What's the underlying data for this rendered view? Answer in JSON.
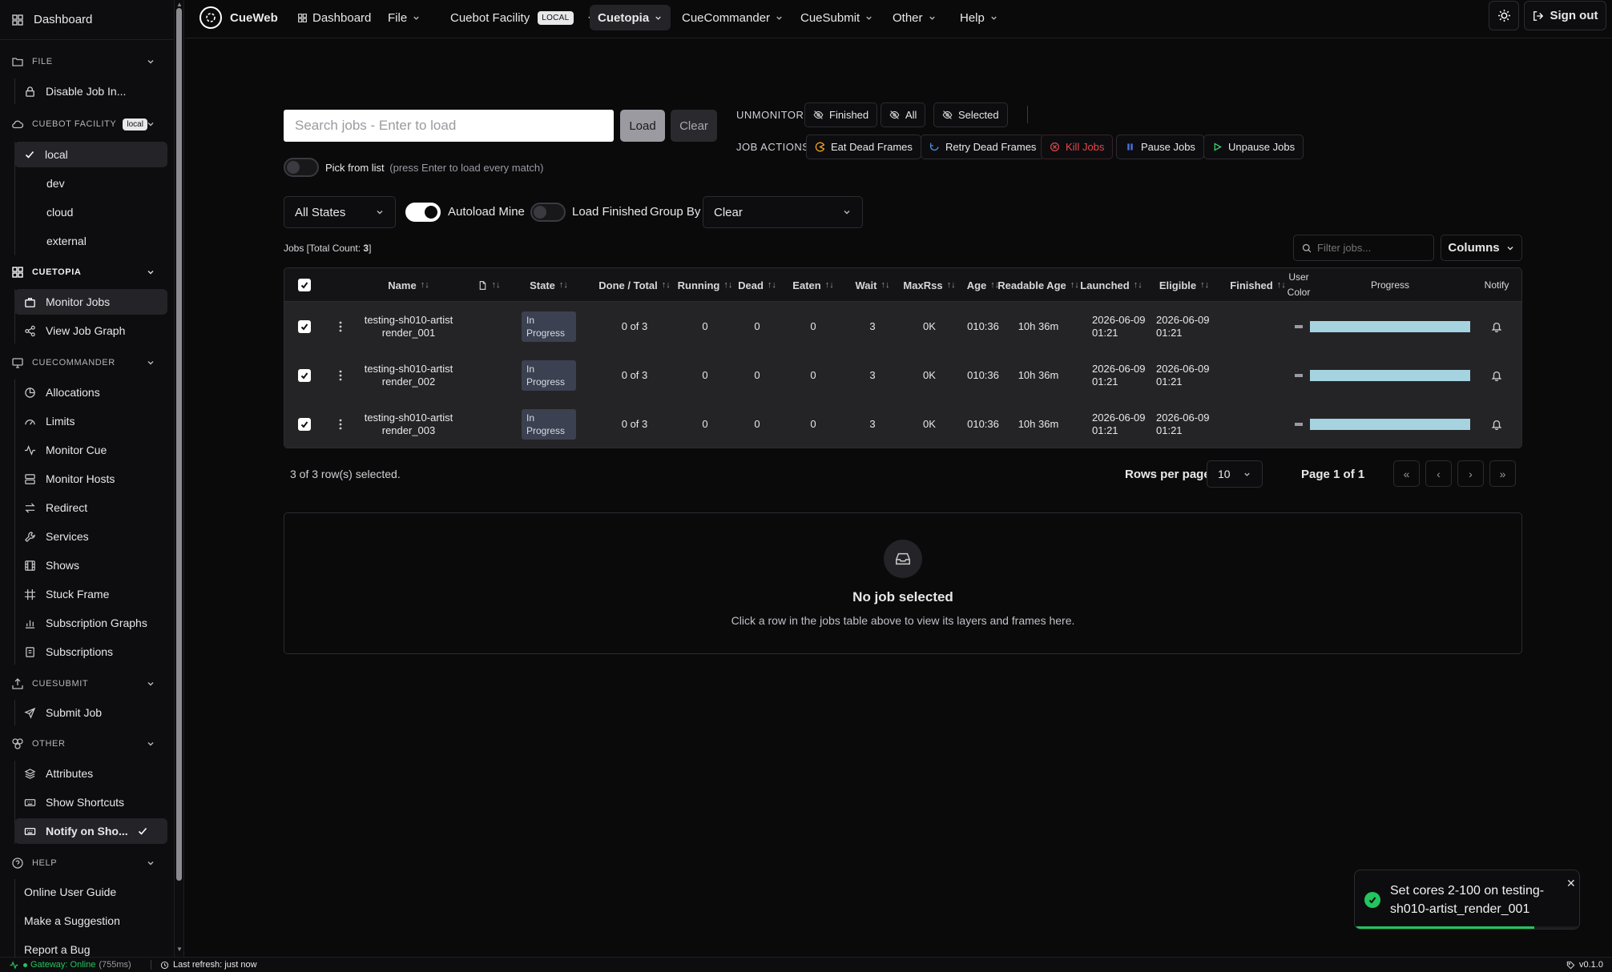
{
  "sidebar": {
    "dashboard": "Dashboard",
    "file_header": "FILE",
    "disable_job": "Disable Job In...",
    "facility_header": "CUEBOT FACILITY",
    "facility_badge": "local",
    "facilities": [
      "local",
      "dev",
      "cloud",
      "external"
    ],
    "cuetopia_header": "CUETOPIA",
    "monitor_jobs": "Monitor Jobs",
    "view_job_graph": "View Job Graph",
    "cuecommander_header": "CUECOMMANDER",
    "cuecommander_items": [
      "Allocations",
      "Limits",
      "Monitor Cue",
      "Monitor Hosts",
      "Redirect",
      "Services",
      "Shows",
      "Stuck Frame",
      "Subscription Graphs",
      "Subscriptions"
    ],
    "cuesubmit_header": "CUESUBMIT",
    "submit_job": "Submit Job",
    "other_header": "OTHER",
    "other_items": [
      "Attributes",
      "Show Shortcuts",
      "Notify on Sho..."
    ],
    "help_header": "HELP",
    "help_items": [
      "Online User Guide",
      "Make a Suggestion",
      "Report a Bug"
    ]
  },
  "topnav": {
    "brand": "CueWeb",
    "dashboard": "Dashboard",
    "file": "File",
    "facility": "Cuebot Facility",
    "facility_badge": "LOCAL",
    "cuetopia": "Cuetopia",
    "cuecommander": "CueCommander",
    "cuesubmit": "CueSubmit",
    "other": "Other",
    "help": "Help",
    "signout": "Sign out"
  },
  "search": {
    "placeholder": "Search jobs - Enter to load",
    "load": "Load",
    "clear": "Clear",
    "pick_label": "Pick from list",
    "pick_hint": "(press Enter to load every match)"
  },
  "unmonitor": {
    "label": "UNMONITOR",
    "finished": "Finished",
    "all": "All",
    "selected": "Selected"
  },
  "job_actions": {
    "label": "JOB ACTIONS",
    "eat": "Eat Dead Frames",
    "retry": "Retry Dead Frames",
    "kill": "Kill Jobs",
    "pause": "Pause Jobs",
    "unpause": "Unpause Jobs"
  },
  "filters": {
    "states": "All States",
    "autoload": "Autoload Mine",
    "load_finished": "Load Finished",
    "group_by": "Group By",
    "group_value": "Clear",
    "filter_placeholder": "Filter jobs...",
    "columns": "Columns"
  },
  "jobs_count": {
    "prefix": "Jobs [Total Count: ",
    "count": "3",
    "suffix": "]"
  },
  "table": {
    "headers": {
      "name": "Name",
      "state": "State",
      "done_total": "Done / Total",
      "running": "Running",
      "dead": "Dead",
      "eaten": "Eaten",
      "wait": "Wait",
      "maxrss": "MaxRss",
      "age": "Age",
      "readable_age": "Readable Age",
      "launched": "Launched",
      "eligible": "Eligible",
      "finished": "Finished",
      "user_color_1": "User",
      "user_color_2": "Color",
      "progress": "Progress",
      "notify": "Notify"
    },
    "rows": [
      {
        "name1": "testing-sh010-artist",
        "name2": "render_001",
        "state1": "In",
        "state2": "Progress",
        "done": "0 of 3",
        "running": "0",
        "dead": "0",
        "eaten": "0",
        "wait": "3",
        "maxrss": "0K",
        "age": "010:36",
        "readable": "10h 36m",
        "launched1": "2026-06-09",
        "launched2": "01:21",
        "eligible1": "2026-06-09",
        "eligible2": "01:21",
        "progress": 1.0
      },
      {
        "name1": "testing-sh010-artist",
        "name2": "render_002",
        "state1": "In",
        "state2": "Progress",
        "done": "0 of 3",
        "running": "0",
        "dead": "0",
        "eaten": "0",
        "wait": "3",
        "maxrss": "0K",
        "age": "010:36",
        "readable": "10h 36m",
        "launched1": "2026-06-09",
        "launched2": "01:21",
        "eligible1": "2026-06-09",
        "eligible2": "01:21",
        "progress": 1.0
      },
      {
        "name1": "testing-sh010-artist",
        "name2": "render_003",
        "state1": "In",
        "state2": "Progress",
        "done": "0 of 3",
        "running": "0",
        "dead": "0",
        "eaten": "0",
        "wait": "3",
        "maxrss": "0K",
        "age": "010:36",
        "readable": "10h 36m",
        "launched1": "2026-06-09",
        "launched2": "01:21",
        "eligible1": "2026-06-09",
        "eligible2": "01:21",
        "progress": 1.0
      }
    ]
  },
  "pagination": {
    "selected": "3 of 3 row(s) selected.",
    "rows_per_page": "Rows per page",
    "rows_value": "10",
    "page": "Page 1 of 1"
  },
  "empty": {
    "title": "No job selected",
    "desc": "Click a row in the jobs table above to view its layers and frames here."
  },
  "toast": {
    "message": "Set cores 2-100 on testing-sh010-artist_render_001",
    "progress": 0.8
  },
  "status": {
    "gateway": "Gateway: Online",
    "latency": "(755ms)",
    "refresh": "Last refresh: just now",
    "version": "v0.1.0"
  },
  "colors": {
    "bg": "#0a0a0b",
    "accent_progress": "#a6d3e0",
    "kill": "#e5484d",
    "eat": "#f5a623",
    "retry": "#4a90e2",
    "pause": "#4a6fe2",
    "unpause": "#3ecf6e",
    "success": "#22c55e"
  }
}
